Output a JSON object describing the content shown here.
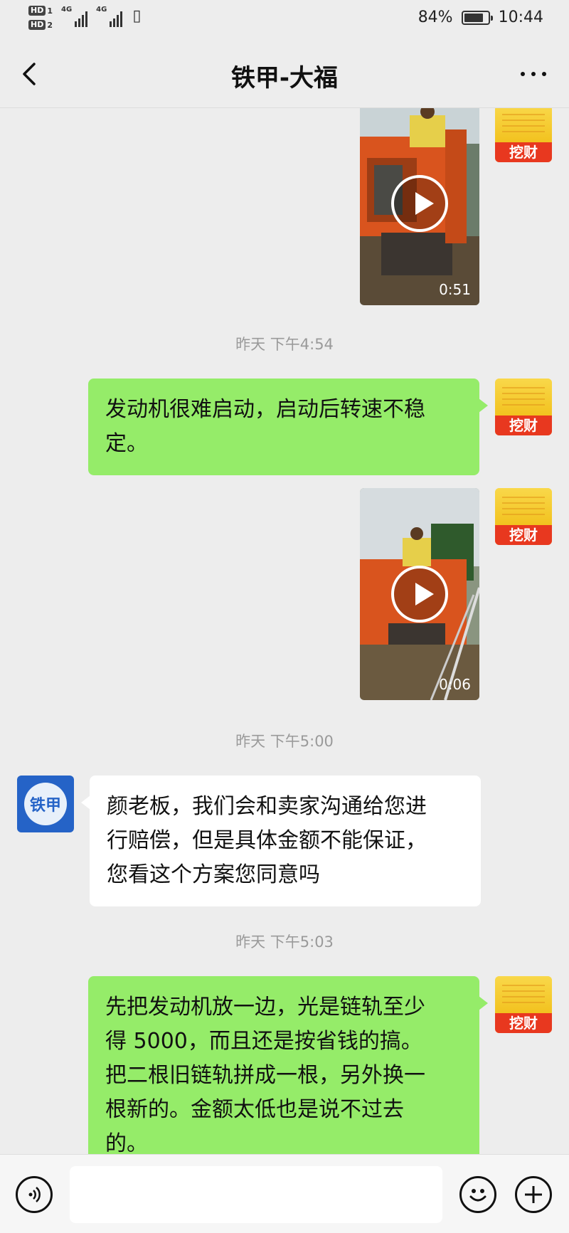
{
  "status_bar": {
    "hd1": "HD",
    "hd1_sub": "1",
    "hd2": "HD",
    "hd2_sub": "2",
    "net1": "4G",
    "net2": "4G",
    "battery": "84%",
    "battery_level": 0.84,
    "time": "10:44"
  },
  "header": {
    "title": "铁甲-大福",
    "back_icon": "chevron-left-icon",
    "more_icon": "more-dots-icon"
  },
  "self_avatar": {
    "label": "挖财",
    "colors": {
      "top": "#f4c928",
      "bottom": "#e8381f"
    }
  },
  "other_avatar": {
    "label": "铁甲",
    "color": "#2563c7"
  },
  "messages": [
    {
      "type": "video",
      "sender": "self",
      "duration": "0:51"
    },
    {
      "type": "time",
      "text": "昨天 下午4:54"
    },
    {
      "type": "text",
      "sender": "self",
      "lines": [
        "发动机很难启动，启动后转速不稳",
        "定。"
      ]
    },
    {
      "type": "video",
      "sender": "self",
      "duration": "0:06"
    },
    {
      "type": "time",
      "text": "昨天 下午5:00"
    },
    {
      "type": "text",
      "sender": "other",
      "lines": [
        "颜老板，我们会和卖家沟通给您进",
        "行赔偿，但是具体金额不能保证，",
        "您看这个方案您同意吗"
      ]
    },
    {
      "type": "time",
      "text": "昨天 下午5:03"
    },
    {
      "type": "text",
      "sender": "self",
      "lines": [
        "先把发动机放一边，光是链轨至少",
        "得 5000，而且还是按省钱的搞。",
        "把二根旧链轨拼成一根，另外换一",
        "根新的。金额太低也是说不过去",
        "的。"
      ]
    }
  ],
  "input_bar": {
    "voice_icon": "voice-icon",
    "emoji_icon": "emoji-icon",
    "plus_icon": "plus-icon"
  },
  "colors": {
    "background": "#ededed",
    "self_bubble": "#95ec69",
    "other_bubble": "#ffffff",
    "timestamp": "#9a9a9a"
  }
}
